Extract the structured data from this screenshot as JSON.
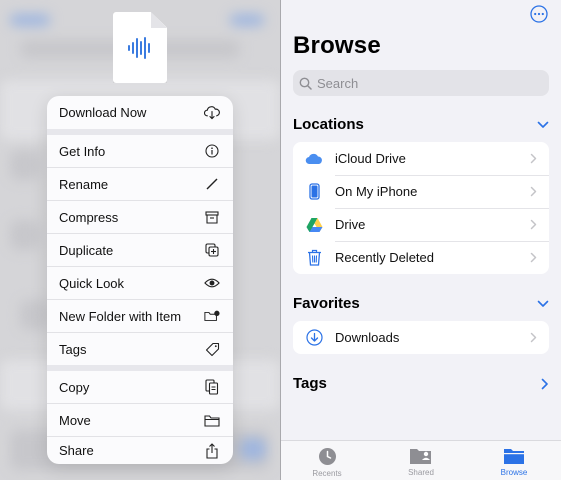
{
  "context_menu": {
    "items": [
      {
        "label": "Download Now",
        "icon": "cloud-download-icon"
      },
      {
        "label": "Get Info",
        "icon": "info-icon"
      },
      {
        "label": "Rename",
        "icon": "pencil-icon"
      },
      {
        "label": "Compress",
        "icon": "archive-box-icon"
      },
      {
        "label": "Duplicate",
        "icon": "duplicate-icon"
      },
      {
        "label": "Quick Look",
        "icon": "eye-icon"
      },
      {
        "label": "New Folder with Item",
        "icon": "folder-badge-icon"
      },
      {
        "label": "Tags",
        "icon": "tag-icon"
      },
      {
        "label": "Copy",
        "icon": "copy-doc-icon"
      },
      {
        "label": "Move",
        "icon": "folder-icon"
      },
      {
        "label": "Share",
        "icon": "share-icon"
      }
    ]
  },
  "browse": {
    "title": "Browse",
    "search_placeholder": "Search",
    "locations": {
      "header": "Locations",
      "items": [
        {
          "label": "iCloud Drive",
          "icon": "icloud-icon"
        },
        {
          "label": "On My iPhone",
          "icon": "iphone-icon"
        },
        {
          "label": "Drive",
          "icon": "google-drive-icon"
        },
        {
          "label": "Recently Deleted",
          "icon": "trash-icon"
        }
      ]
    },
    "favorites": {
      "header": "Favorites",
      "items": [
        {
          "label": "Downloads",
          "icon": "download-circle-icon"
        }
      ]
    },
    "tags": {
      "header": "Tags"
    }
  },
  "tab_bar": {
    "tabs": [
      {
        "label": "Recents",
        "icon": "clock-icon",
        "active": false
      },
      {
        "label": "Shared",
        "icon": "shared-folder-icon",
        "active": false
      },
      {
        "label": "Browse",
        "icon": "folder-fill-icon",
        "active": true
      }
    ]
  },
  "colors": {
    "accent": "#2b72e6",
    "background": "#f2f2f7",
    "menu_background": "#fbfbfd"
  }
}
